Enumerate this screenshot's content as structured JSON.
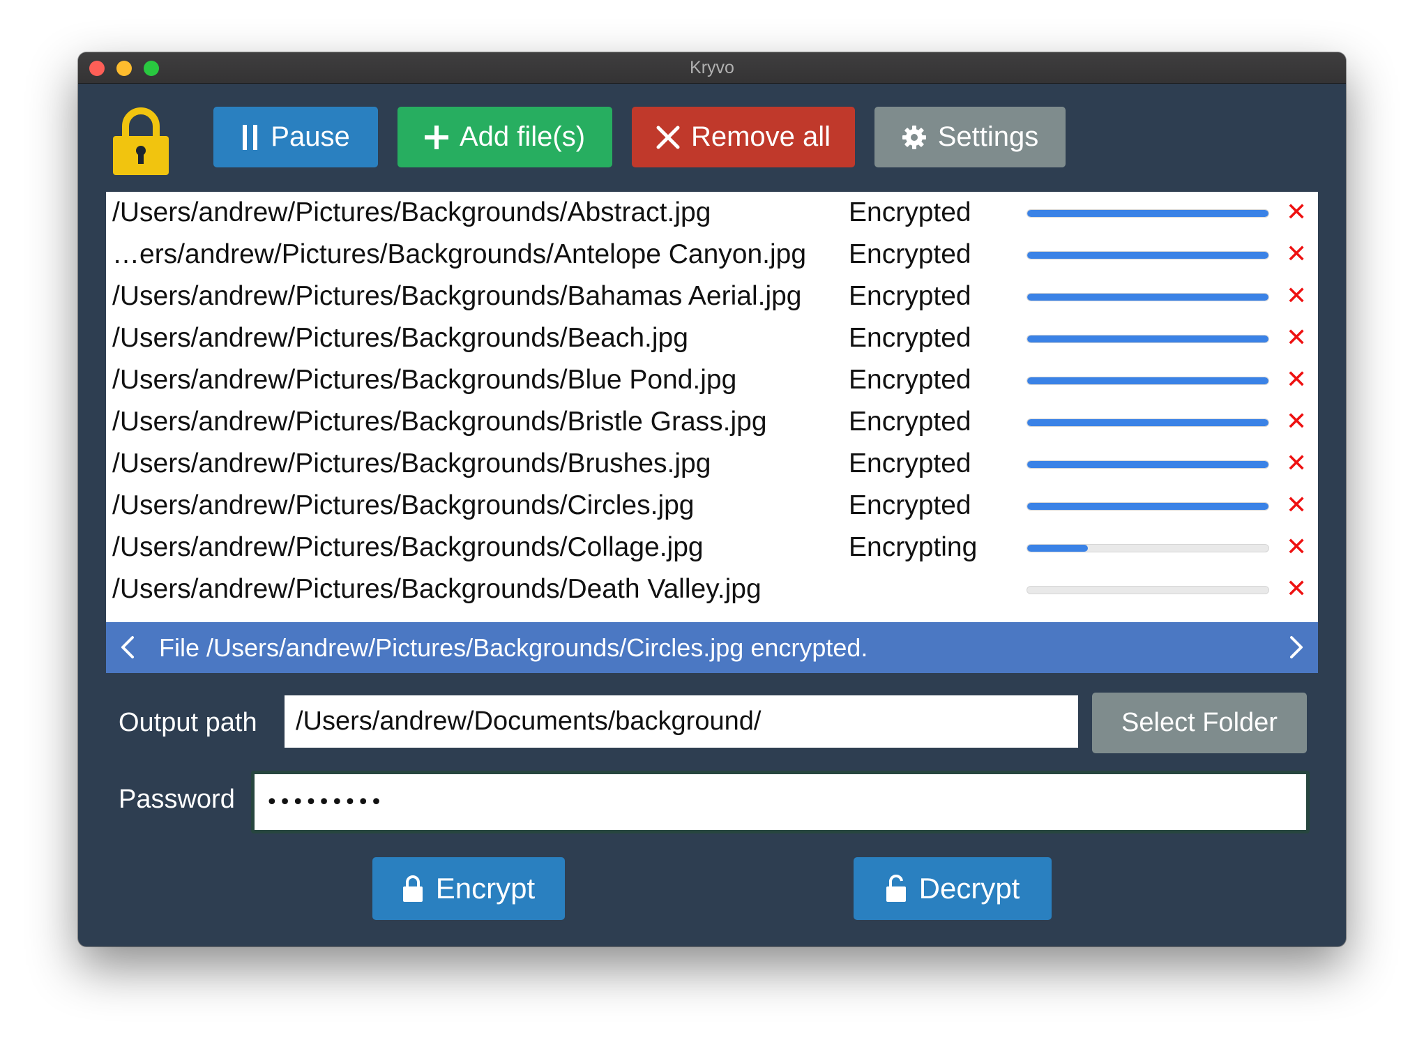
{
  "window": {
    "title": "Kryvo"
  },
  "toolbar": {
    "pause_label": "Pause",
    "add_label": "Add file(s)",
    "remove_all_label": "Remove all",
    "settings_label": "Settings"
  },
  "files": [
    {
      "path": "/Users/andrew/Pictures/Backgrounds/Abstract.jpg",
      "status": "Encrypted",
      "progress": 1.0
    },
    {
      "path": "…ers/andrew/Pictures/Backgrounds/Antelope Canyon.jpg",
      "status": "Encrypted",
      "progress": 1.0
    },
    {
      "path": "/Users/andrew/Pictures/Backgrounds/Bahamas Aerial.jpg",
      "status": "Encrypted",
      "progress": 1.0
    },
    {
      "path": "/Users/andrew/Pictures/Backgrounds/Beach.jpg",
      "status": "Encrypted",
      "progress": 1.0
    },
    {
      "path": "/Users/andrew/Pictures/Backgrounds/Blue Pond.jpg",
      "status": "Encrypted",
      "progress": 1.0
    },
    {
      "path": "/Users/andrew/Pictures/Backgrounds/Bristle Grass.jpg",
      "status": "Encrypted",
      "progress": 1.0
    },
    {
      "path": "/Users/andrew/Pictures/Backgrounds/Brushes.jpg",
      "status": "Encrypted",
      "progress": 1.0
    },
    {
      "path": "/Users/andrew/Pictures/Backgrounds/Circles.jpg",
      "status": "Encrypted",
      "progress": 1.0
    },
    {
      "path": "/Users/andrew/Pictures/Backgrounds/Collage.jpg",
      "status": "Encrypting",
      "progress": 0.25
    },
    {
      "path": "/Users/andrew/Pictures/Backgrounds/Death Valley.jpg",
      "status": "",
      "progress": 0.0
    }
  ],
  "status_bar": {
    "message": "File /Users/andrew/Pictures/Backgrounds/Circles.jpg encrypted."
  },
  "output": {
    "label": "Output path",
    "value": "/Users/andrew/Documents/background/",
    "select_folder_label": "Select Folder"
  },
  "password": {
    "label": "Password",
    "value": "•••••••••"
  },
  "actions": {
    "encrypt_label": "Encrypt",
    "decrypt_label": "Decrypt"
  },
  "icons": {
    "logo": "padlock-icon",
    "pause": "pause-icon",
    "add": "plus-icon",
    "remove_all": "close-icon",
    "settings": "gear-icon",
    "row_remove": "remove-x-icon",
    "status_prev": "chevron-left-icon",
    "status_next": "chevron-right-icon",
    "encrypt": "lock-icon",
    "decrypt": "unlock-icon"
  },
  "colors": {
    "window_bg": "#2e3e51",
    "pause": "#2a80c0",
    "add": "#27ae60",
    "remove_all": "#c0392b",
    "settings": "#7f8c8d",
    "status_bar": "#4b78c3",
    "progress_fill": "#3a82e6",
    "remove_x": "#ee1111"
  }
}
